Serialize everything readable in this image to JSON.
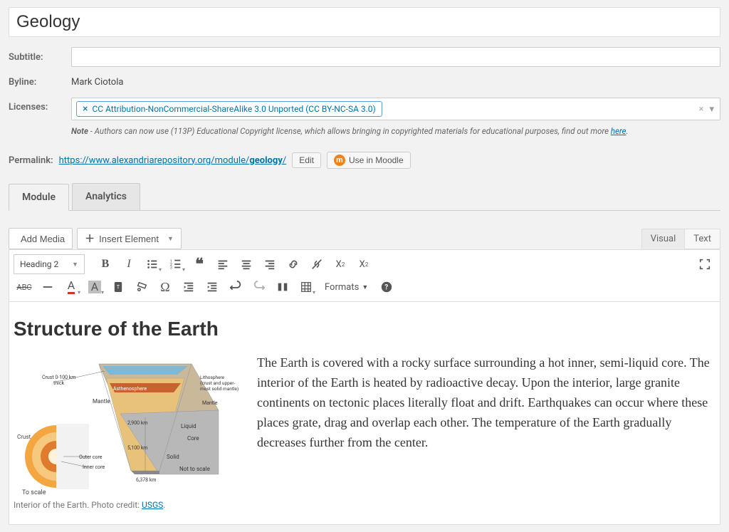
{
  "title_value": "Geology",
  "labels": {
    "subtitle": "Subtitle:",
    "byline": "Byline:",
    "licenses": "Licenses:",
    "permalink": "Permalink:"
  },
  "byline_value": "Mark Ciotola",
  "license_tag": "CC Attribution-NonCommercial-ShareAlike 3.0 Unported (CC BY-NC-SA 3.0)",
  "note_prefix": "Note",
  "note_text": " - Authors can now use (113P) Educational Copyright license, which allows bringing in copyrighted materials for educational purposes, find out more ",
  "note_link": "here",
  "permalink_base": "https://www.alexandriarepository.org/module/",
  "permalink_slug": "geology",
  "permalink_trail": "/",
  "edit_btn": "Edit",
  "moodle_btn": "Use in Moodle",
  "tabs": {
    "module": "Module",
    "analytics": "Analytics"
  },
  "toolbar": {
    "add_media": "Add Media",
    "insert_element": "Insert Element",
    "visual": "Visual",
    "text": "Text",
    "format_select": "Heading 2",
    "formats_label": "Formats"
  },
  "content": {
    "heading": "Structure of the Earth",
    "paragraph": "The Earth is covered with a rocky surface surrounding a hot inner, semi-liquid core. The interior of the Earth is heated by radioactive decay. Upon the interior, large granite continents on tectonic places literally float and drift. Earthquakes can occur where these places grate, drag and overlap each other. The temperature of the Earth gradually decreases further from the center.",
    "caption_text": "Interior of the Earth. Photo credit: ",
    "caption_link": "USGS",
    "caption_trail": "."
  }
}
